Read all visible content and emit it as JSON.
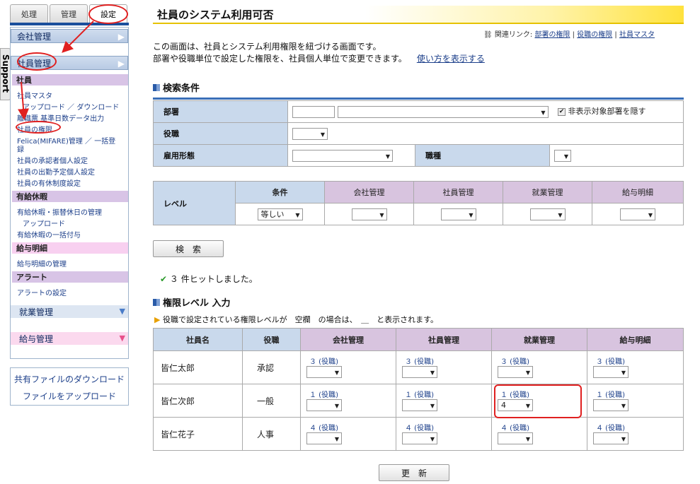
{
  "tabs": [
    "処理",
    "管理",
    "設定"
  ],
  "support": "Support",
  "nav": {
    "company": "会社管理",
    "employee": "社員管理",
    "sect_employee": "社員",
    "links": [
      "社員マスタ",
      "アップロード ／ ダウンロード",
      "離職票 基準日数データ出力",
      "社員の権限",
      "Felica(MIFARE)管理 ／ 一括登",
      "録",
      "社員の承認者個人設定",
      "社員の出勤予定個人設定",
      "社員の有休制度設定"
    ],
    "sect_leave": "有給休暇",
    "leave_links": [
      "有給休暇・振替休日の管理",
      "アップロード",
      "有給休暇の一括付与"
    ],
    "sect_pay": "給与明細",
    "pay_links": [
      "給与明細の管理"
    ],
    "sect_alert": "アラート",
    "alert_links": [
      "アラートの設定"
    ],
    "work": "就業管理",
    "salary": "給与管理",
    "file_download": "共有ファイルのダウンロード",
    "file_upload": "ファイルをアップロード"
  },
  "title": "社員のシステム利用可否",
  "related": {
    "label": "関連リンク:",
    "links": [
      "部署の権限",
      "役職の権限",
      "社員マスタ"
    ],
    "sep": "|"
  },
  "desc": {
    "line1": "この画面は、社員とシステム利用権限を紐づける画面です。",
    "line2": "部署や役職単位で設定した権限を、社員個人単位で変更できます。",
    "howto": "使い方を表示する"
  },
  "search": {
    "heading": "検索条件",
    "dept": "部署",
    "hide_label": "非表示対象部署を隠す",
    "position": "役職",
    "employment": "雇用形態",
    "jobtype": "職種",
    "level": "レベル",
    "condition": "条件",
    "cond_value": "等しい",
    "cols": [
      "会社管理",
      "社員管理",
      "就業管理",
      "給与明細"
    ],
    "button": "検　索"
  },
  "result": "３ 件ヒットしました。",
  "perm": {
    "heading": "権限レベル 入力",
    "note": "役職で設定されている権限レベルが　空欄　の場合は、　＿　と表示されます。",
    "headers": [
      "社員名",
      "役職",
      "会社管理",
      "社員管理",
      "就業管理",
      "給与明細"
    ],
    "rows": [
      {
        "name": "皆仁太郎",
        "pos": "承認",
        "lv": [
          "３ (役職)",
          "３ (役職)",
          "３ (役職)",
          "３ (役職)"
        ],
        "val": [
          "",
          "",
          "",
          ""
        ]
      },
      {
        "name": "皆仁次郎",
        "pos": "一般",
        "lv": [
          "１ (役職)",
          "１ (役職)",
          "１ (役職)",
          "１ (役職)"
        ],
        "val": [
          "",
          "",
          "4",
          ""
        ]
      },
      {
        "name": "皆仁花子",
        "pos": "人事",
        "lv": [
          "４ (役職)",
          "４ (役職)",
          "４ (役職)",
          "４ (役職)"
        ],
        "val": [
          "",
          "",
          "",
          ""
        ]
      }
    ],
    "update": "更　新"
  }
}
